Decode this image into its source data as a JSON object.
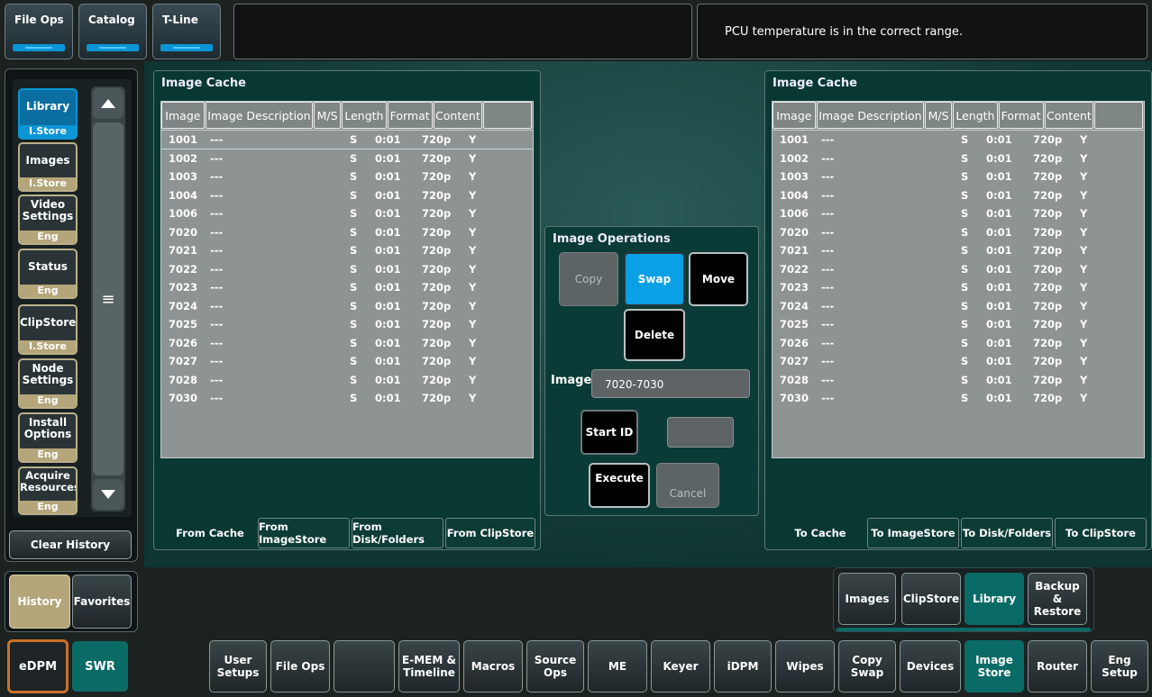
{
  "top": {
    "buttons": [
      "File Ops",
      "Catalog",
      "T-Line"
    ],
    "status_message": "PCU temperature is in the correct range."
  },
  "sidebar": {
    "items": [
      {
        "label": "Library",
        "sub": "I.Store"
      },
      {
        "label": "Images",
        "sub": "I.Store"
      },
      {
        "label": "Video Settings",
        "sub": "Eng  Setup"
      },
      {
        "label": "Status",
        "sub": "Eng  Setup"
      },
      {
        "label": "ClipStore",
        "sub": "I.Store"
      },
      {
        "label": "Node Settings",
        "sub": "Eng  Setup"
      },
      {
        "label": "Install Options",
        "sub": "Eng  Setup"
      },
      {
        "label": "Acquire Resources",
        "sub": "Eng  Setup"
      }
    ],
    "scroll_middle_glyph": "≡",
    "clear_history": "Clear History",
    "history": "History",
    "favorites": "Favorites",
    "edpm": "eDPM",
    "swr": "SWR"
  },
  "left_panel": {
    "title": "Image Cache",
    "tabs": [
      "From Cache",
      "From ImageStore",
      "From Disk/Folders",
      "From ClipStore"
    ]
  },
  "right_panel": {
    "title": "Image Cache",
    "tabs": [
      "To Cache",
      "To ImageStore",
      "To Disk/Folders",
      "To ClipStore"
    ]
  },
  "table": {
    "columns": [
      "Image",
      "Image Description",
      "M/S",
      "Length",
      "Format",
      "Content",
      ""
    ],
    "rows": [
      [
        "1001",
        "---",
        "S",
        "0:01",
        "720p",
        "Y"
      ],
      [
        "1002",
        "---",
        "S",
        "0:01",
        "720p",
        "Y"
      ],
      [
        "1003",
        "---",
        "S",
        "0:01",
        "720p",
        "Y"
      ],
      [
        "1004",
        "---",
        "S",
        "0:01",
        "720p",
        "Y"
      ],
      [
        "1006",
        "---",
        "S",
        "0:01",
        "720p",
        "Y"
      ],
      [
        "7020",
        "---",
        "S",
        "0:01",
        "720p",
        "Y"
      ],
      [
        "7021",
        "---",
        "S",
        "0:01",
        "720p",
        "Y"
      ],
      [
        "7022",
        "---",
        "S",
        "0:01",
        "720p",
        "Y"
      ],
      [
        "7023",
        "---",
        "S",
        "0:01",
        "720p",
        "Y"
      ],
      [
        "7024",
        "---",
        "S",
        "0:01",
        "720p",
        "Y"
      ],
      [
        "7025",
        "---",
        "S",
        "0:01",
        "720p",
        "Y"
      ],
      [
        "7026",
        "---",
        "S",
        "0:01",
        "720p",
        "Y"
      ],
      [
        "7027",
        "---",
        "S",
        "0:01",
        "720p",
        "Y"
      ],
      [
        "7028",
        "---",
        "S",
        "0:01",
        "720p",
        "Y"
      ],
      [
        "7030",
        "---",
        "S",
        "0:01",
        "720p",
        "Y"
      ]
    ]
  },
  "ops": {
    "title": "Image Operations",
    "copy": "Copy",
    "swap": "Swap",
    "move": "Move",
    "delete": "Delete",
    "images_label": "Images",
    "images_value": "7020-7030",
    "start_id": "Start ID",
    "start_id_value": "",
    "execute": "Execute",
    "cancel": "Cancel"
  },
  "submenu": [
    "Images",
    "ClipStore",
    "Library",
    "Backup & Restore"
  ],
  "bottom": [
    "User Setups",
    "File Ops",
    "",
    "E-MEM & Timeline",
    "Macros",
    "Source Ops",
    "ME",
    "Keyer",
    "iDPM",
    "Wipes",
    "Copy Swap",
    "Devices",
    "Image Store",
    "Router",
    "Eng Setup"
  ],
  "colors": {
    "accent": "#0a95d6",
    "teal": "#0a6b66",
    "tan": "#b4a67a"
  }
}
